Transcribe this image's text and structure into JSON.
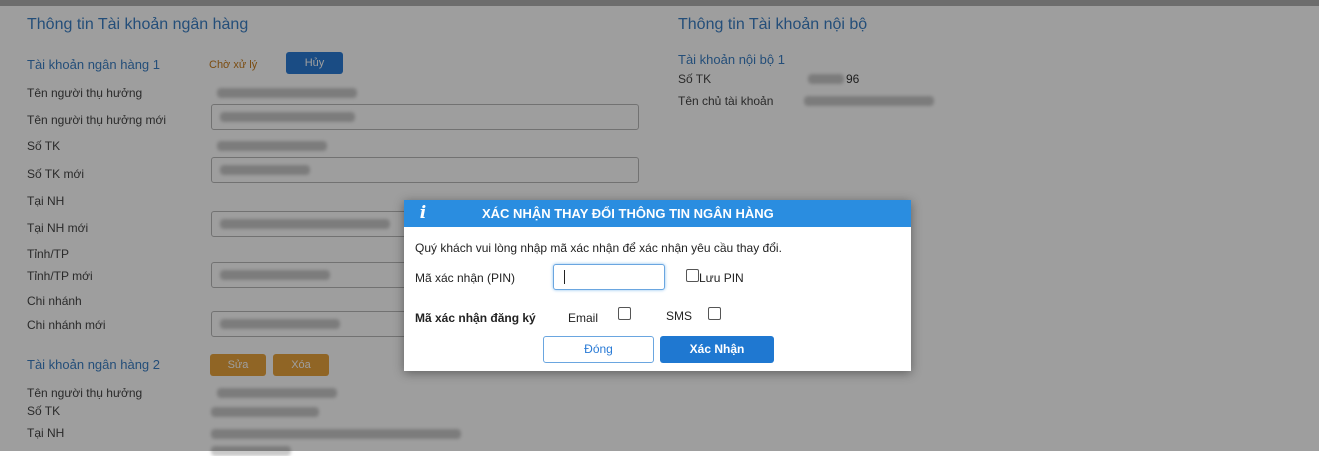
{
  "left": {
    "section_title": "Thông tin Tài khoản ngân hàng",
    "account1": {
      "title": "Tài khoản ngân hàng 1",
      "status": "Chờ xử lý",
      "cancel_button": "Hủy",
      "labels": {
        "beneficiary": "Tên người thụ hưởng",
        "beneficiary_new": "Tên người thụ hưởng mới",
        "account_no": "Số TK",
        "account_no_new": "Số TK mới",
        "bank": "Tại NH",
        "bank_new": "Tại NH mới",
        "province": "Tỉnh/TP",
        "province_new": "Tỉnh/TP mới",
        "branch": "Chi nhánh",
        "branch_new": "Chi nhánh mới"
      }
    },
    "account2": {
      "title": "Tài khoản ngân hàng 2",
      "edit_button": "Sửa",
      "delete_button": "Xóa",
      "labels": {
        "beneficiary": "Tên người thụ hưởng",
        "account_no": "Số TK",
        "bank": "Tại NH"
      }
    }
  },
  "right": {
    "section_title": "Thông tin Tài khoản nội bộ",
    "internal1": {
      "title": "Tài khoản nội bộ 1",
      "account_no_label": "Số TK",
      "account_no_suffix": "96",
      "owner_label": "Tên chủ tài khoản"
    }
  },
  "modal": {
    "icon": "info-icon",
    "title": "XÁC NHẬN THAY ĐỔI THÔNG TIN NGÂN HÀNG",
    "message": "Quý khách vui lòng nhập mã xác nhận để xác nhận yêu cầu thay đổi.",
    "pin_label": "Mã xác nhận (PIN)",
    "pin_value": "",
    "save_pin_label": "Lưu PIN",
    "register_label": "Mã xác nhận đăng ký",
    "email_label": "Email",
    "sms_label": "SMS",
    "close_button": "Đóng",
    "confirm_button": "Xác Nhận"
  },
  "colors": {
    "accent_blue": "#2a8de0",
    "button_orange": "#e8a43c",
    "status_orange": "#c77b1a"
  }
}
